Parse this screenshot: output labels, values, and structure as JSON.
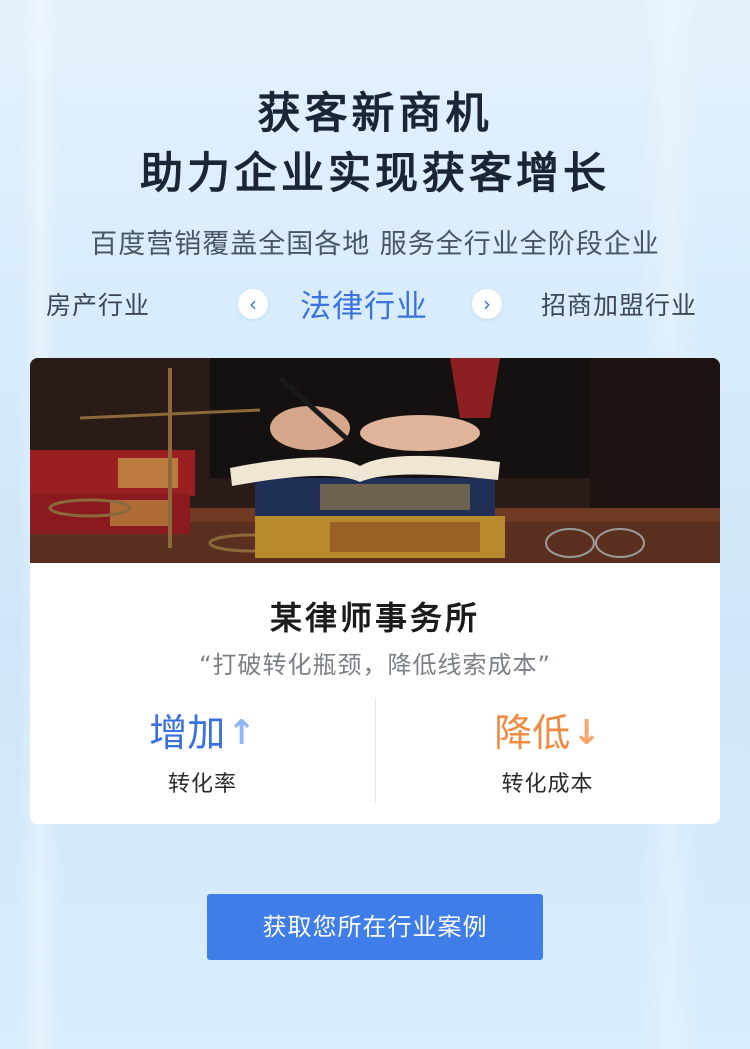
{
  "hero": {
    "line1": "获客新商机",
    "line2": "助力企业实现获客增长",
    "subtitle": "百度营销覆盖全国各地 服务全行业全阶段企业"
  },
  "tabs": {
    "prev": "房产行业",
    "active": "法律行业",
    "next": "招商加盟行业",
    "prev_icon": "chevron-left-icon",
    "next_icon": "chevron-right-icon"
  },
  "case": {
    "firm_name": "某律师事务所",
    "quote": "“打破转化瓶颈，降低线索成本”",
    "stats": [
      {
        "value": "增加",
        "label": "转化率",
        "direction": "up",
        "color": "#3a6fe2"
      },
      {
        "value": "降低",
        "label": "转化成本",
        "direction": "down",
        "color": "#f08a40"
      }
    ]
  },
  "cta": {
    "label": "获取您所在行业案例"
  },
  "colors": {
    "accent": "#3f7ee8",
    "active_tab": "#3a72e0",
    "down": "#f08a40"
  }
}
